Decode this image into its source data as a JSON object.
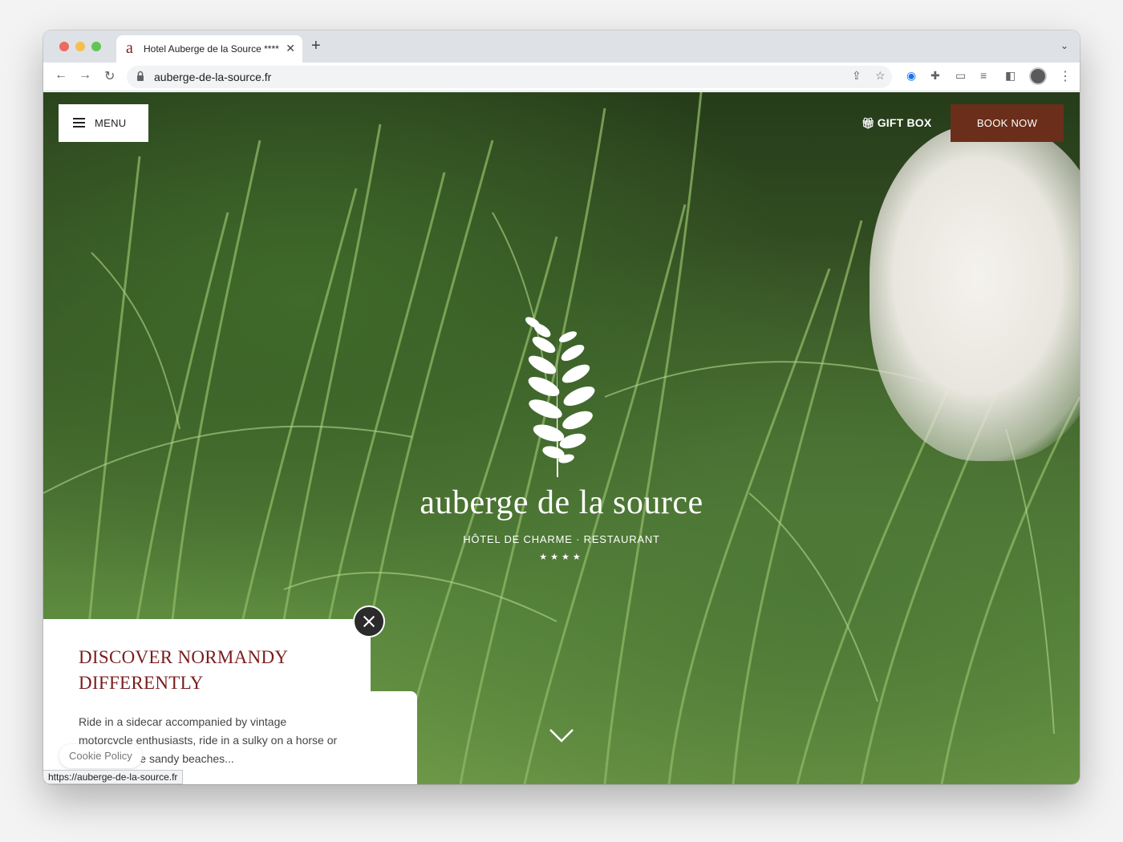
{
  "browser": {
    "tab_favicon": "a",
    "tab_title": "Hotel Auberge de la Source ****",
    "url": "auberge-de-la-source.fr",
    "status_url": "https://auberge-de-la-source.fr"
  },
  "header": {
    "menu_label": "MENU",
    "gift_label": "GIFT BOX",
    "book_label": "BOOK NOW",
    "book_color": "#6a2e1a"
  },
  "hero": {
    "brand": "auberge de la source",
    "tagline": "HÔTEL DE CHARME · RESTAURANT",
    "stars": "★★★★"
  },
  "promo": {
    "title": "DISCOVER NORMANDY DIFFERENTLY",
    "text": "Ride in a sidecar accompanied by vintage motorcycle enthusiasts, ride in a sulky on a horse or along the fine sandy beaches...",
    "title_color": "#7a1c1c"
  },
  "cookie": {
    "label": "Cookie Policy"
  }
}
